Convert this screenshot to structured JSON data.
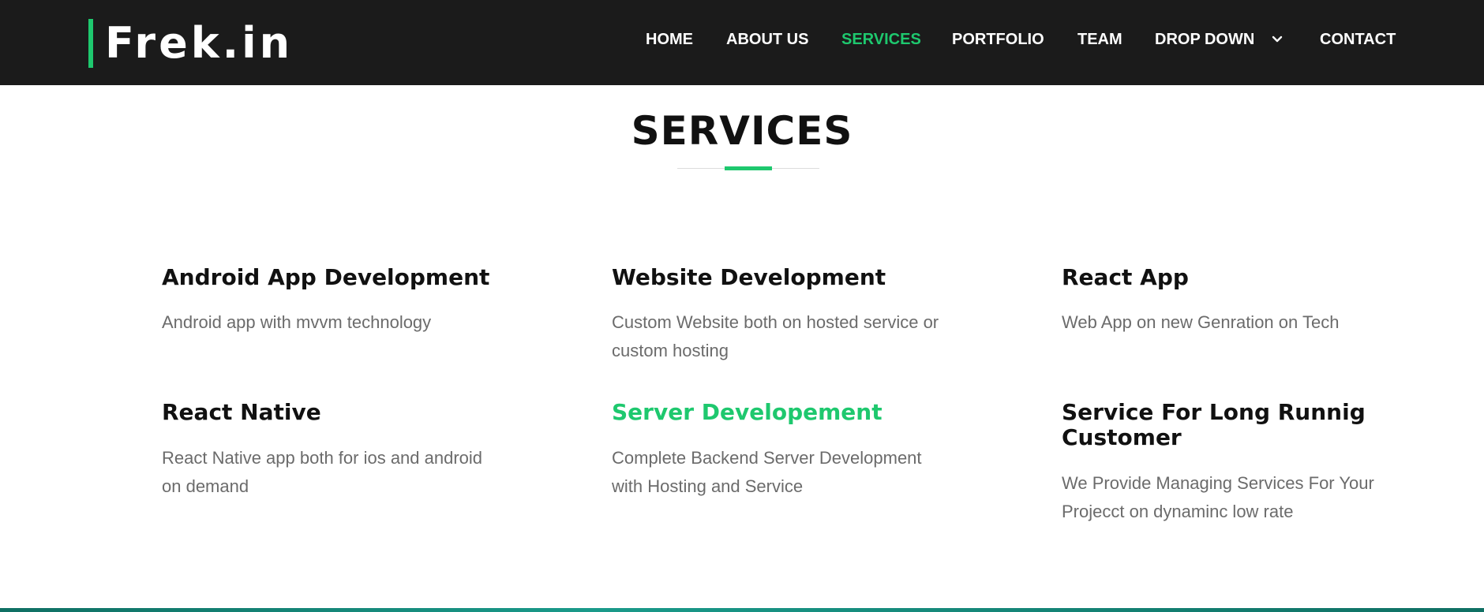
{
  "brand": {
    "name": "Frek.in",
    "accent_color": "#1ec86e"
  },
  "nav": {
    "items": [
      {
        "label": "HOME",
        "active": false
      },
      {
        "label": "ABOUT US",
        "active": false
      },
      {
        "label": "SERVICES",
        "active": true
      },
      {
        "label": "PORTFOLIO",
        "active": false
      },
      {
        "label": "TEAM",
        "active": false
      },
      {
        "label": "DROP DOWN",
        "active": false,
        "icon": "chevron-down-icon"
      },
      {
        "label": "CONTACT",
        "active": false
      }
    ]
  },
  "section": {
    "title": "SERVICES"
  },
  "services": [
    {
      "title": "Android App Development",
      "description": "Android app with mvvm technology",
      "highlighted": false
    },
    {
      "title": "Website Development",
      "description": "Custom Website both on hosted service or custom hosting",
      "highlighted": false
    },
    {
      "title": "React App",
      "description": "Web App on new Genration on Tech",
      "highlighted": false
    },
    {
      "title": "React Native",
      "description": "React Native app both for ios and android on demand",
      "highlighted": false
    },
    {
      "title": "Server Developement",
      "description": "Complete Backend Server Development with Hosting and Service",
      "highlighted": true
    },
    {
      "title": "Service For Long Runnig Customer",
      "description": "We Provide Managing Services For Your Projecct on dynaminc low rate",
      "highlighted": false
    }
  ],
  "colors": {
    "navbar_bg": "#1b1b1b",
    "accent": "#1ec86e",
    "body_text": "#6b6b6b",
    "heading": "#111111"
  }
}
